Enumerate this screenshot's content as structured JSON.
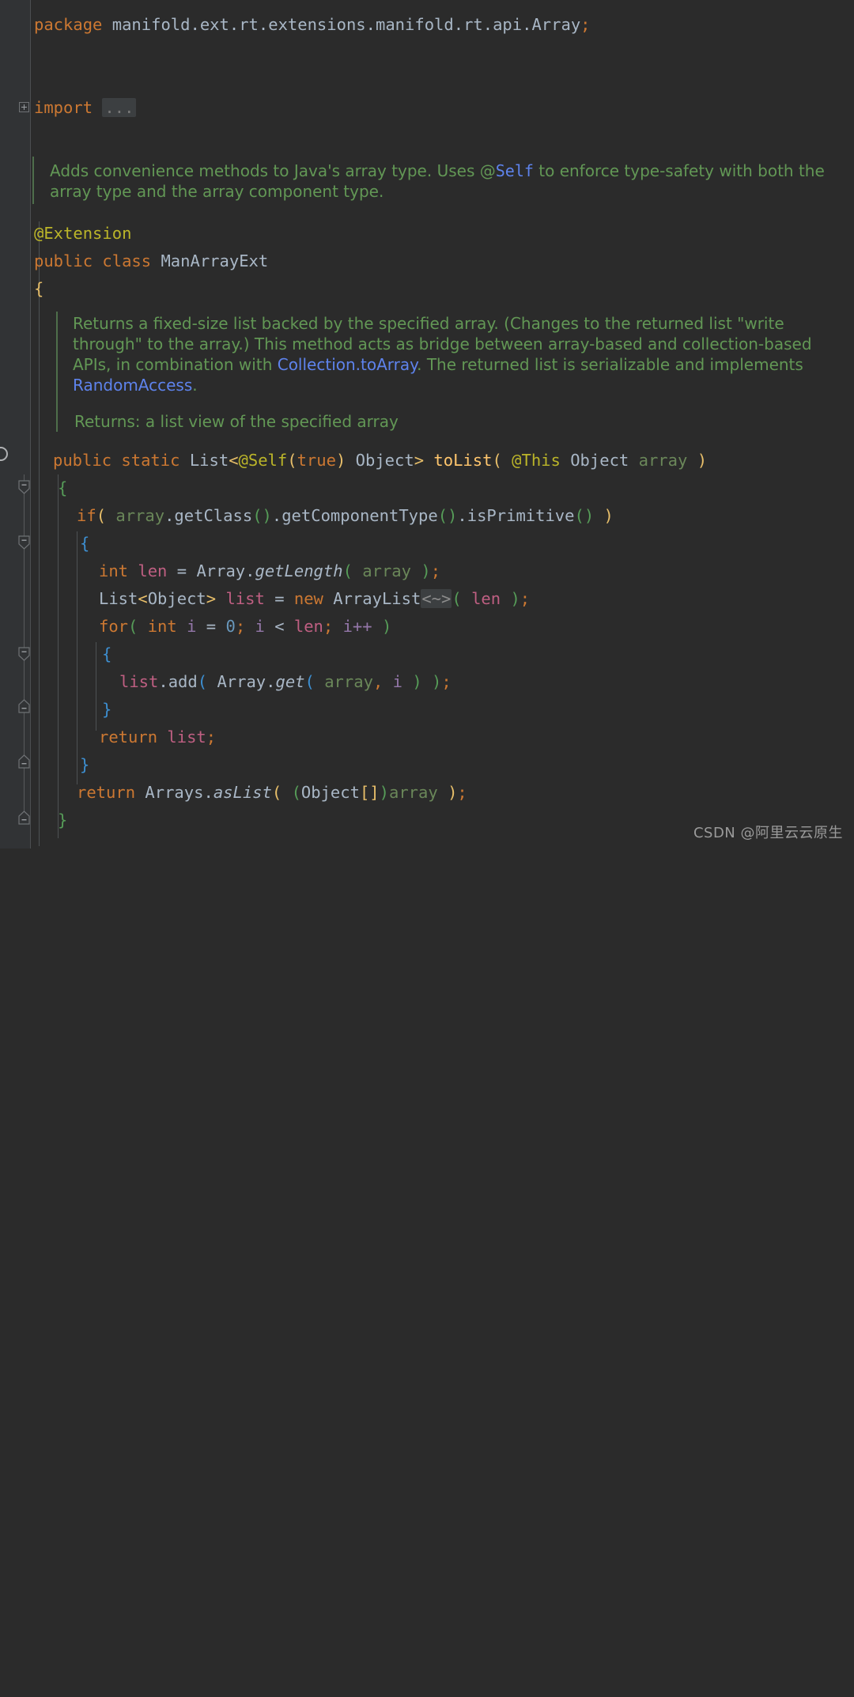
{
  "editor": {
    "theme": "darcula",
    "background": "#2B2B2B",
    "gutter_background": "#313335",
    "default_text_color": "#A9B7C6"
  },
  "gutter": {
    "import_fold_icon": "plus-square-icon",
    "fold_markers": [
      {
        "name": "fold-start-method-body",
        "direction": "down"
      },
      {
        "name": "fold-start-if-body",
        "direction": "down"
      },
      {
        "name": "fold-start-for-body",
        "direction": "down"
      },
      {
        "name": "fold-end-for-body",
        "direction": "up"
      },
      {
        "name": "fold-end-if-body",
        "direction": "up"
      },
      {
        "name": "fold-end-method-body",
        "direction": "up"
      }
    ],
    "run_gutter_icon": "run-method-icon"
  },
  "code": {
    "package": {
      "keyword": "package",
      "name": "manifold.ext.rt.extensions.manifold.rt.api.Array",
      "semicolon": ";"
    },
    "import": {
      "keyword": "import",
      "folded_placeholder": "..."
    },
    "class_doc": {
      "text_before_link": "Adds convenience methods to Java's array type. Uses @",
      "link": "Self",
      "text_after_link": " to enforce type-safety with both the array type and the array component type."
    },
    "class_annotation": "@Extension",
    "class_decl": {
      "modifier": "public",
      "keyword": "class",
      "name": "ManArrayExt"
    },
    "class_open_brace": "{",
    "method_doc": {
      "paragraph_1": "Returns a fixed-size list backed by the specified array. (Changes to the returned list \"write through\" to the array.) This method acts as bridge between array-based and collection-based APIs, in combination with ",
      "ref_1": "Collection.toArray",
      "paragraph_2": ". The returned list is serializable and implements ",
      "ref_2": "RandomAccess",
      "paragraph_3": ".",
      "returns_tag": "Returns: a list view of the specified array"
    },
    "method_signature": {
      "modifier": "public",
      "static_kw": "static",
      "return_type": "List",
      "generic_open": "<",
      "self_annotation": "@Self",
      "self_arg_open": "(",
      "self_arg": "true",
      "self_arg_close": ")",
      "type_arg": " Object",
      "generic_close": ">",
      "method_name": "toList",
      "paren_open": "(",
      "this_annotation": "@This",
      "param_type": "Object",
      "param_name": "array",
      "paren_close": ")"
    },
    "method_open_brace": "{",
    "if_statement": {
      "keyword": "if",
      "paren_open": "(",
      "receiver": "array",
      "call_1": ".getClass",
      "call_1_parens": "()",
      "call_2": ".getComponentType",
      "call_2_parens": "()",
      "call_3": ".isPrimitive",
      "call_3_parens": "()",
      "paren_close": ")"
    },
    "if_open_brace": "{",
    "len_decl": {
      "type": "int",
      "var": "len",
      "equals": "=",
      "class_ref": "Array",
      "dot": ".",
      "method": "getLength",
      "paren_open": "(",
      "arg": "array",
      "paren_close": ")",
      "semicolon": ";"
    },
    "list_decl": {
      "type": "List",
      "generic_open": "<",
      "type_arg": "Object",
      "generic_close": ">",
      "var": "list",
      "equals": "=",
      "new_kw": "new",
      "class_ref": "ArrayList",
      "diamond_inlay": "<~>",
      "paren_open": "(",
      "arg": "len",
      "paren_close": ")",
      "semicolon": ";"
    },
    "for_statement": {
      "keyword": "for",
      "paren_open": "(",
      "init_type": "int",
      "init_var": "i",
      "init_equals": "=",
      "init_value": "0",
      "semicolon_1": ";",
      "cond_left": "i",
      "cond_op": "<",
      "cond_right": "len",
      "semicolon_2": ";",
      "update": "i++",
      "paren_close": ")"
    },
    "for_open_brace": "{",
    "add_statement": {
      "receiver": "list",
      "dot": ".",
      "method": "add",
      "paren_open": "(",
      "class_ref": "Array",
      "inner_dot": ".",
      "inner_method": "get",
      "inner_paren_open": "(",
      "arg_1": "array",
      "comma": ",",
      "arg_2": "i",
      "inner_paren_close": ")",
      "paren_close": ")",
      "semicolon": ";"
    },
    "for_close_brace": "}",
    "return_list": {
      "keyword": "return",
      "value": "list",
      "semicolon": ";"
    },
    "if_close_brace": "}",
    "return_aslist": {
      "keyword": "return",
      "class_ref": "Arrays",
      "dot": ".",
      "method": "asList",
      "paren_open": "(",
      "cast_open": "(",
      "cast_type": "Object",
      "cast_brackets": "[]",
      "cast_close": ")",
      "arg": "array",
      "paren_close": ")",
      "semicolon": ";"
    },
    "method_close_brace": "}"
  },
  "watermark": "CSDN @阿里云云原生"
}
